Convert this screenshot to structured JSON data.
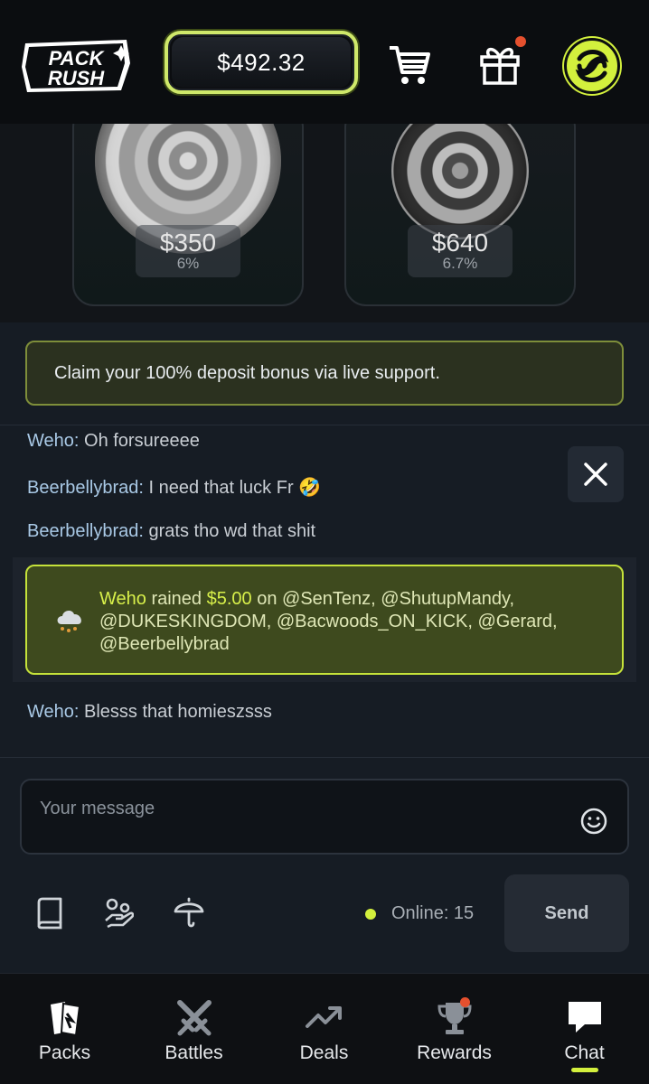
{
  "header": {
    "logo_text": [
      "PACK",
      "RUSH"
    ],
    "balance": "$492.32"
  },
  "cards": [
    {
      "price": "$350",
      "chance": "6%"
    },
    {
      "price": "$640",
      "chance": "6.7%"
    }
  ],
  "chat": {
    "notice": "Claim your 100% deposit bonus via live support.",
    "messages": [
      {
        "user": "Weho:",
        "text": " Oh forsureeee"
      },
      {
        "user": "Beerbellybrad:",
        "text": " I need that luck Fr 🤣"
      },
      {
        "user": "Beerbellybrad:",
        "text": " grats tho wd that shit"
      },
      {
        "user": "Weho:",
        "text": " Blesss that homieszsss"
      }
    ],
    "rain": {
      "user": "Weho",
      "verb": " rained ",
      "amount": "$5.00",
      "rest": " on @SenTenz, @ShutupMandy, @DUKESKINGDOM, @Bacwoods_ON_KICK, @Gerard, @Beerbellybrad"
    },
    "input_placeholder": "Your message",
    "online": "Online: 15",
    "send": "Send"
  },
  "nav": [
    "Packs",
    "Battles",
    "Deals",
    "Rewards",
    "Chat"
  ],
  "colors": {
    "accent": "#d3f03d",
    "notification": "#e5502e"
  },
  "icons": [
    "cart-icon",
    "gift-icon",
    "avatar-icon",
    "close-icon",
    "rain-cloud-icon",
    "emoji-icon",
    "book-icon",
    "hand-coin-icon",
    "umbrella-icon",
    "packs-icon",
    "battles-icon",
    "deals-icon",
    "rewards-icon",
    "chat-icon"
  ]
}
